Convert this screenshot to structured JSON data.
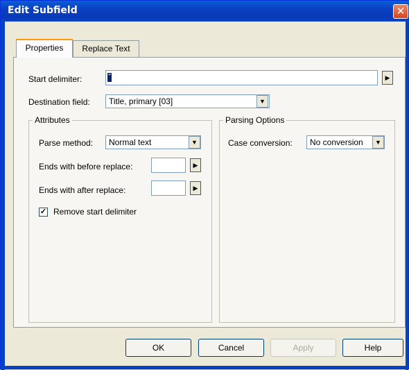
{
  "window": {
    "title": "Edit Subfield"
  },
  "tabs": [
    {
      "label": "Properties",
      "active": true
    },
    {
      "label": "Replace Text",
      "active": false
    }
  ],
  "start_delimiter": {
    "label": "Start delimiter:",
    "value": "\""
  },
  "destination_field": {
    "label": "Destination field:",
    "value": "Title, primary [03]"
  },
  "attributes": {
    "title": "Attributes",
    "parse_method": {
      "label": "Parse method:",
      "value": "Normal text"
    },
    "ends_before": {
      "label": "Ends with before replace:",
      "value": ""
    },
    "ends_after": {
      "label": "Ends with after replace:",
      "value": ""
    },
    "remove_start": {
      "label": "Remove start delimiter",
      "checked": true
    }
  },
  "parsing_options": {
    "title": "Parsing Options",
    "case_conversion": {
      "label": "Case conversion:",
      "value": "No conversion"
    }
  },
  "buttons": {
    "ok": "OK",
    "cancel": "Cancel",
    "apply": "Apply",
    "help": "Help"
  },
  "icons": {
    "close": "close-icon",
    "dropdown": "chevron-down-icon",
    "arrow": "arrow-right-icon"
  }
}
